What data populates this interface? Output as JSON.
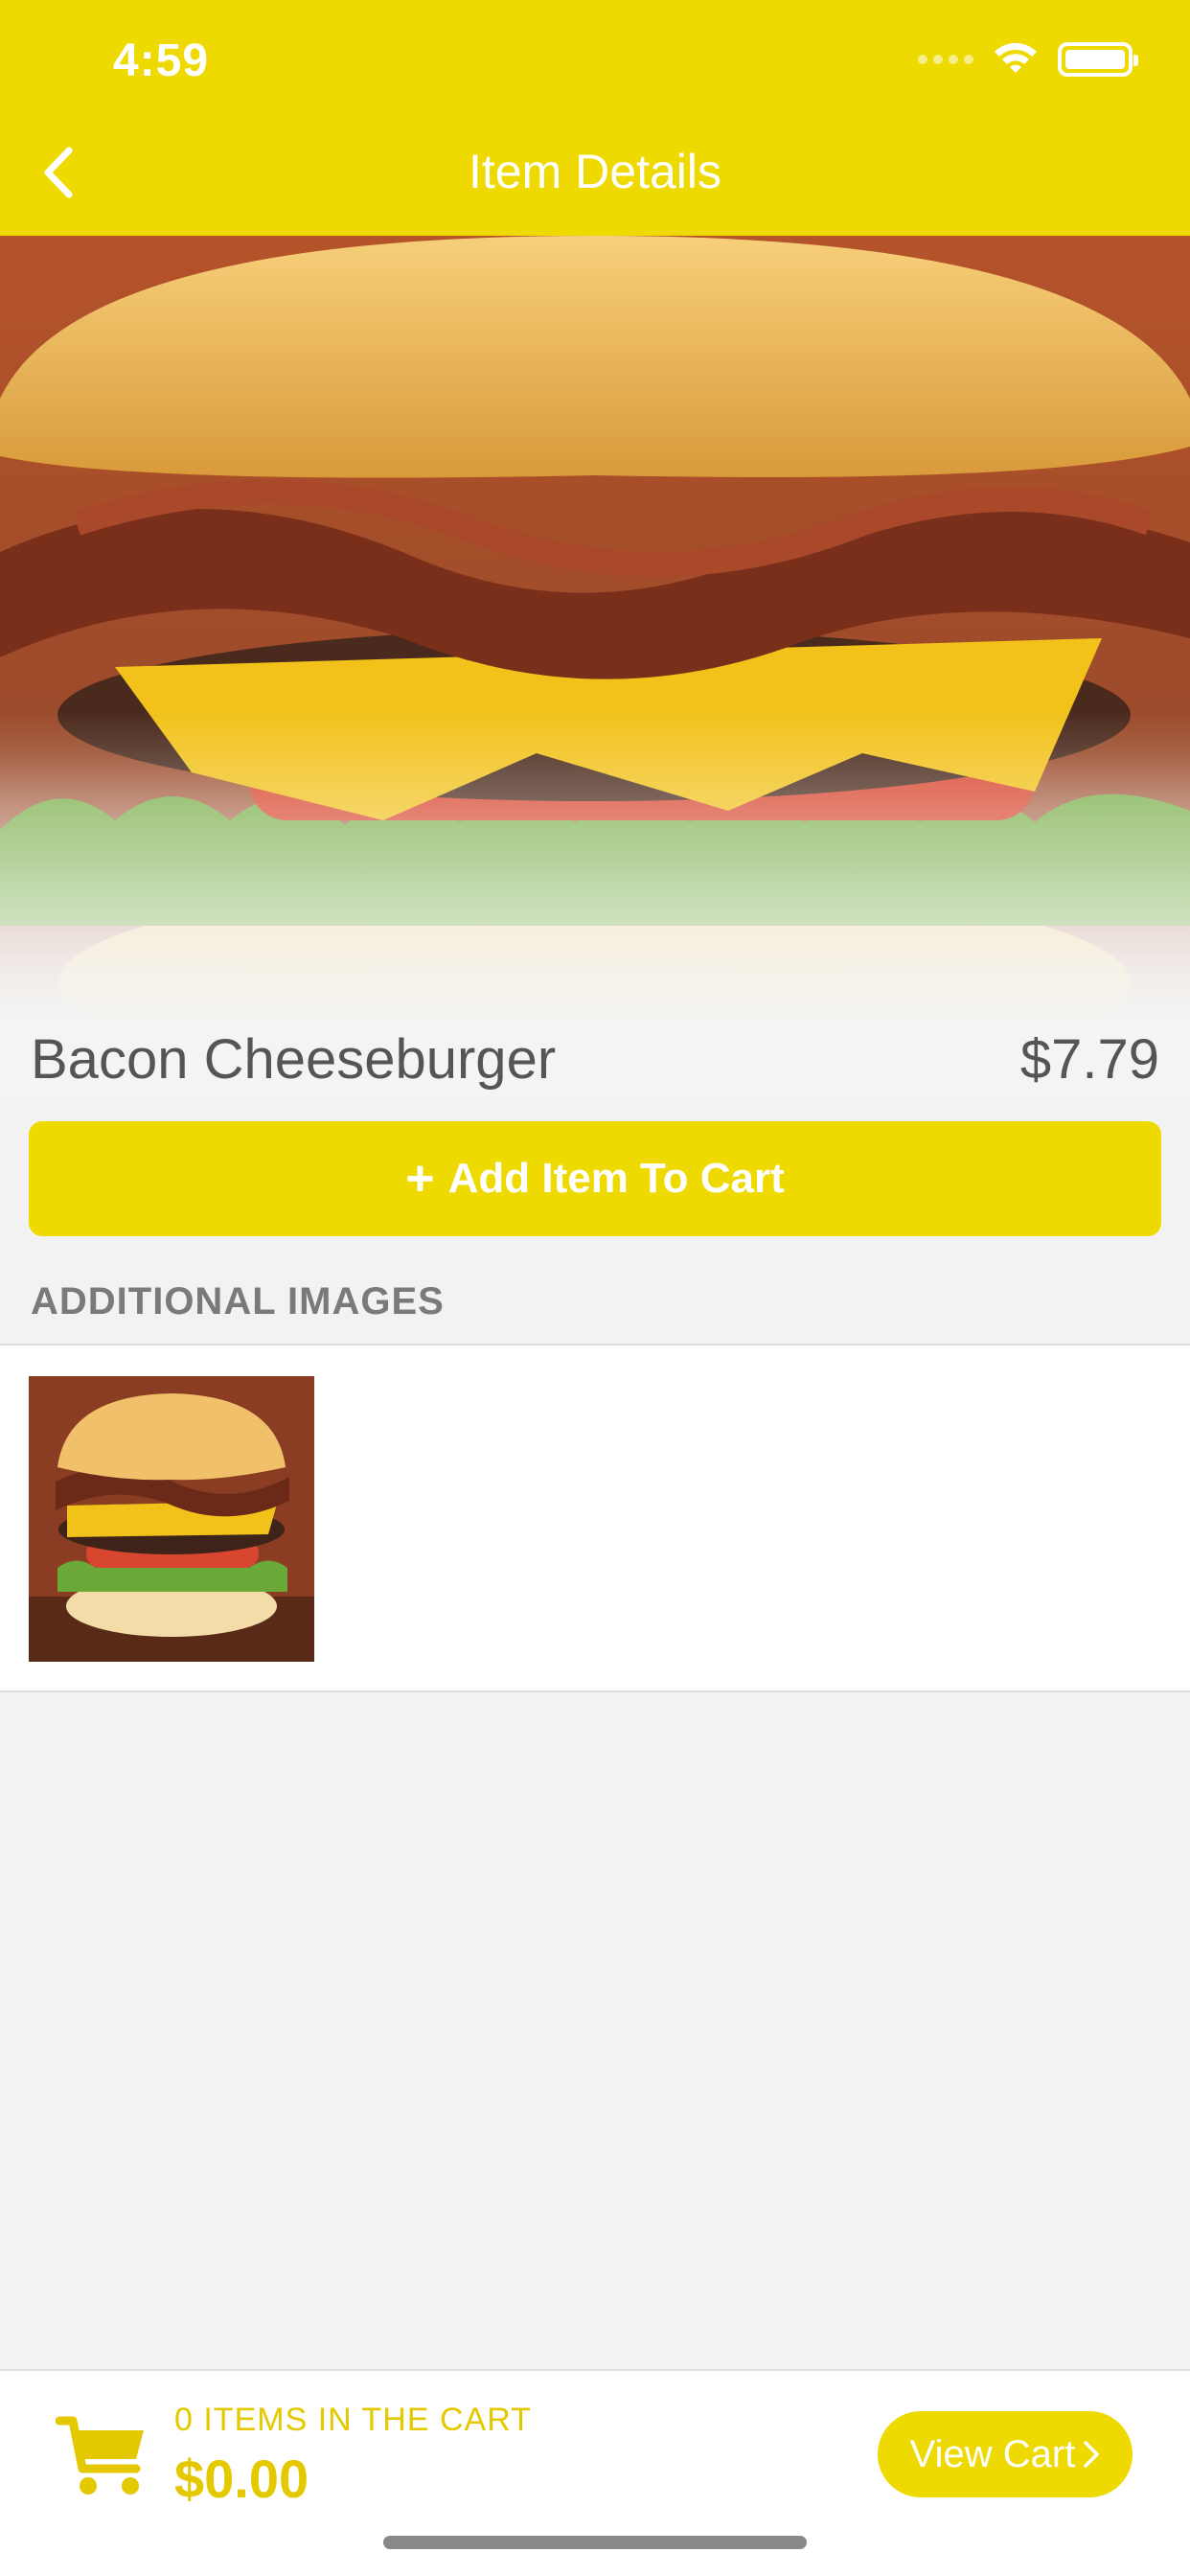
{
  "status_bar": {
    "time": "4:59"
  },
  "header": {
    "title": "Item Details",
    "back_icon": "chevron-left-icon"
  },
  "item": {
    "name": "Bacon Cheeseburger",
    "price": "$7.79"
  },
  "actions": {
    "add_to_cart_label": "Add Item To Cart",
    "add_icon": "plus-icon"
  },
  "additional_images": {
    "header": "ADDITIONAL IMAGES"
  },
  "cart": {
    "count_label": "0 ITEMS IN THE CART",
    "total": "$0.00",
    "view_cart_label": "View Cart",
    "cart_icon": "shopping-cart-icon"
  },
  "colors": {
    "accent": "#eed900",
    "cart_text": "#e4c800",
    "background": "#f2f2f2"
  }
}
